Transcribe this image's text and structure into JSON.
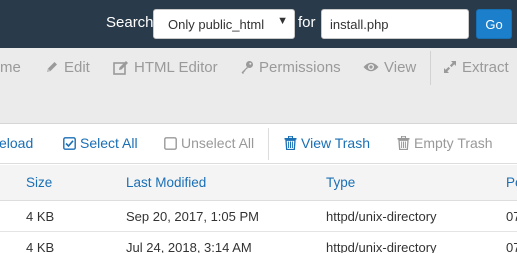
{
  "search": {
    "label": "Search",
    "scope_value": "Only public_html",
    "for_label": "for",
    "query": "install.php",
    "go_label": "Go"
  },
  "toolbar": {
    "items": [
      {
        "label": "me",
        "icon": "rename-icon"
      },
      {
        "label": "Edit",
        "icon": "pencil-icon"
      },
      {
        "label": "HTML Editor",
        "icon": "edit-square-icon"
      },
      {
        "label": "Permissions",
        "icon": "key-icon"
      },
      {
        "label": "View",
        "icon": "eye-icon"
      },
      {
        "label": "Extract",
        "icon": "expand-icon"
      }
    ]
  },
  "actions": {
    "reload": "eload",
    "select_all": "Select All",
    "unselect_all": "Unselect All",
    "view_trash": "View Trash",
    "empty_trash": "Empty Trash"
  },
  "table": {
    "columns": [
      "Size",
      "Last Modified",
      "Type",
      "Pe"
    ],
    "rows": [
      {
        "size": "4 KB",
        "modified": "Sep 20, 2017, 1:05 PM",
        "type": "httpd/unix-directory",
        "perm": "07"
      },
      {
        "size": "4 KB",
        "modified": "Jul 24, 2018, 3:14 AM",
        "type": "httpd/unix-directory",
        "perm": "07"
      }
    ]
  },
  "colors": {
    "header_bg": "#293a4a",
    "go_button": "#1b7fcc",
    "link": "#1a6fb5",
    "disabled": "#999999"
  }
}
